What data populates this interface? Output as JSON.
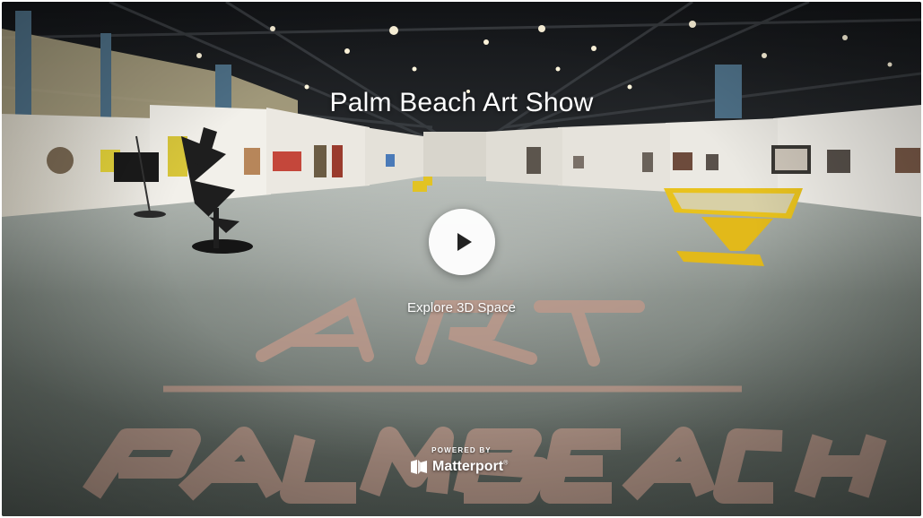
{
  "showcase": {
    "title": "Palm Beach Art Show",
    "explore_label": "Explore 3D Space",
    "play_icon": "play-icon"
  },
  "branding": {
    "powered_by": "POWERED BY",
    "name": "Matterport",
    "trademark": "®",
    "logo_icon": "matterport-logo-icon"
  },
  "scene": {
    "floor_text_art": "ART",
    "floor_text_palm_beach": "PALM BEACH"
  },
  "colors": {
    "floor": "#5c655f",
    "ceiling": "#1c1f23",
    "wall": "#e9e8e3",
    "kiosk": "#e8c21e",
    "floor_lettering": "#c49a86"
  }
}
